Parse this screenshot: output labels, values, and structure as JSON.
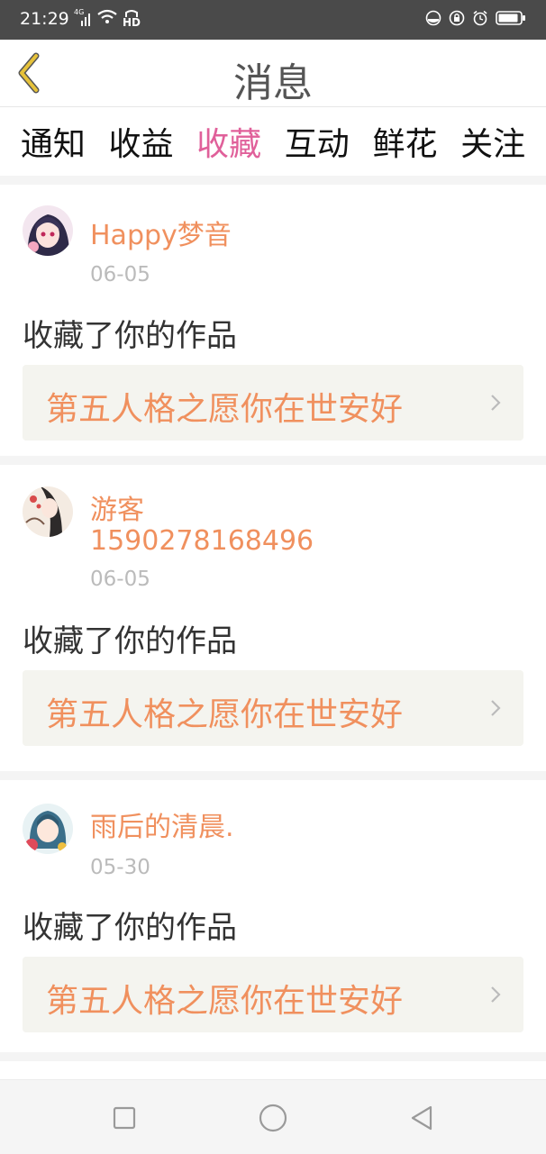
{
  "status_bar": {
    "time": "21:29",
    "net_type": "4G",
    "hd_label": "HD",
    "left_icons": [
      "signal-icon",
      "wifi-icon",
      "hd-call-icon"
    ],
    "right_icons": [
      "mute-icon",
      "lock-icon",
      "alarm-icon",
      "battery-icon"
    ]
  },
  "header": {
    "title": "消息",
    "back_icon": "back-chevron-icon"
  },
  "tabs": [
    {
      "label": "通知"
    },
    {
      "label": "收益"
    },
    {
      "label": "收藏",
      "active": true
    },
    {
      "label": "互动"
    },
    {
      "label": "鲜花"
    },
    {
      "label": "关注"
    }
  ],
  "notifications": [
    {
      "user": "Happy梦音",
      "date": "06-05",
      "action": "收藏了你的作品",
      "work_title": "第五人格之愿你在世安好"
    },
    {
      "user": "游客\n1590278168496",
      "user_line1": "游客",
      "user_line2": "1590278168496",
      "date": "06-05",
      "action": "收藏了你的作品",
      "work_title": "第五人格之愿你在世安好"
    },
    {
      "user": "雨后的清晨.",
      "date": "05-30",
      "action": "收藏了你的作品",
      "work_title": "第五人格之愿你在世安好"
    }
  ],
  "nav_bar": {
    "buttons": [
      "recents-square-icon",
      "home-circle-icon",
      "back-triangle-icon"
    ]
  },
  "colors": {
    "accent_pink": "#e0609a",
    "username_orange": "#f0905e",
    "link_bg": "#f4f4ef",
    "back_arrow": "#e6c23a"
  }
}
